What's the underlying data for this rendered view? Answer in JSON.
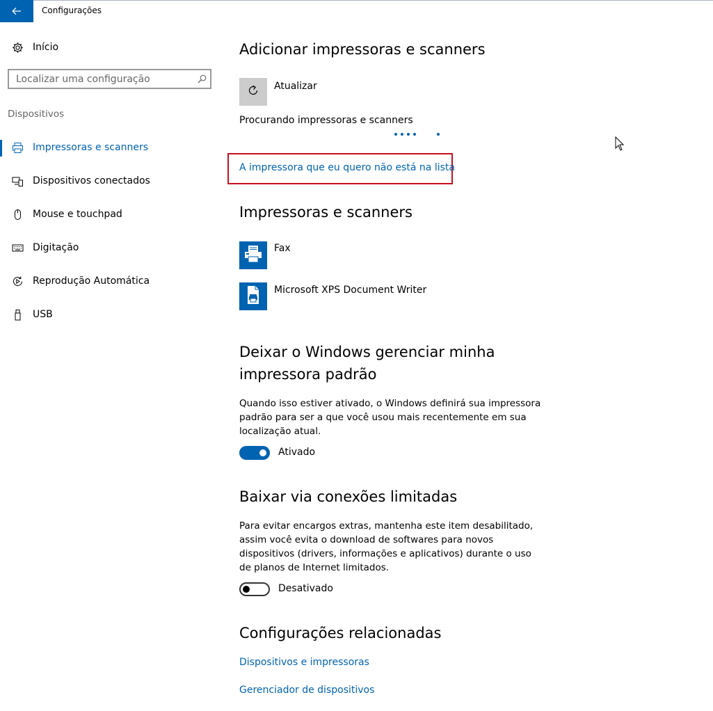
{
  "window": {
    "title": "Configurações"
  },
  "sidebar": {
    "home_label": "Início",
    "search_placeholder": "Localizar uma configuração",
    "section_label": "Dispositivos",
    "items": [
      {
        "label": "Impressoras e scanners",
        "icon": "printer-icon",
        "active": true
      },
      {
        "label": "Dispositivos conectados",
        "icon": "connected-devices-icon",
        "active": false
      },
      {
        "label": "Mouse e touchpad",
        "icon": "mouse-icon",
        "active": false
      },
      {
        "label": "Digitação",
        "icon": "keyboard-icon",
        "active": false
      },
      {
        "label": "Reprodução Automática",
        "icon": "autoplay-icon",
        "active": false
      },
      {
        "label": "USB",
        "icon": "usb-icon",
        "active": false
      }
    ]
  },
  "main": {
    "add_section": {
      "heading": "Adicionar impressoras e scanners",
      "refresh_label": "Atualizar",
      "searching_text": "Procurando impressoras e scanners",
      "not_listed_link": "A impressora que eu quero não está na lista"
    },
    "printers_section": {
      "heading": "Impressoras e scanners",
      "printers": [
        {
          "name": "Fax",
          "icon": "fax-icon"
        },
        {
          "name": "Microsoft XPS Document Writer",
          "icon": "document-printer-icon"
        }
      ]
    },
    "default_printer_section": {
      "heading_line1": "Deixar o Windows gerenciar minha",
      "heading_line2": "impressora padrão",
      "description": "Quando isso estiver ativado, o Windows definirá sua impressora padrão para ser a que você usou mais recentemente em sua localização atual.",
      "toggle_state": true,
      "toggle_label": "Ativado"
    },
    "metered_section": {
      "heading": "Baixar via conexões limitadas",
      "description": "Para evitar encargos extras, mantenha este item desabilitado, assim você evita o download de softwares para novos dispositivos (drivers, informações e aplicativos) durante o uso de planos de Internet limitados.",
      "toggle_state": false,
      "toggle_label": "Desativado"
    },
    "related_section": {
      "heading": "Configurações relacionadas",
      "links": [
        "Dispositivos e impressoras",
        "Gerenciador de dispositivos"
      ]
    }
  },
  "colors": {
    "accent": "#0063b1",
    "highlight_box": "#c50f1f",
    "tile_gray": "#cccccc"
  }
}
